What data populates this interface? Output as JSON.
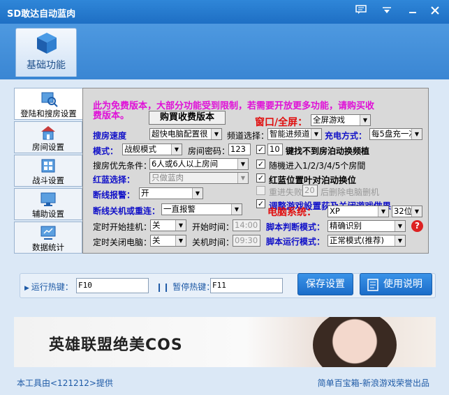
{
  "window": {
    "title": "SD敢达自动蓝肉"
  },
  "maintab": {
    "label": "基础功能"
  },
  "sidenav": [
    {
      "label": "登陆和搜房设置"
    },
    {
      "label": "房间设置"
    },
    {
      "label": "战斗设置"
    },
    {
      "label": "辅助设置"
    },
    {
      "label": "数据统计"
    }
  ],
  "panel": {
    "notice": "此为免费版本，大部分功能受到限制，若需要开放更多功能，请购买收费版本。",
    "notice_line1": "此为免费版本，大部分功能受到限制，若需要开放更多功能，请购买收",
    "notice_line2": "费版本。",
    "buy_button": "购買收费版本",
    "window_mode_label": "窗口/全屏：",
    "window_mode_value": "全屏游戏",
    "search_speed_label": "搜房速度",
    "search_speed_value": "超快电脑配置很",
    "channel_label": "频道选择：",
    "channel_value": "智能进频道",
    "charge_label": "充电方式：",
    "charge_value": "每5盘充一次",
    "mode_label": "模式：",
    "mode_value": "战舰模式",
    "room_pwd_label": "房间密码：",
    "room_pwd_value": "123",
    "chk1_value": "10",
    "chk1_label": "键找不到房泊动换频植",
    "priority_label": "搜房优先条件：",
    "priority_value": "6人或6人以上房间",
    "chk2_label": "随機进入1/2/3/4/5个房間",
    "redblue_label": "红蓝选择：",
    "redblue_value": "只做蓝肉",
    "chk3_label": "红蓝位置叶对泊动换位",
    "chk4_pre": "重进失败",
    "chk4_value": "20",
    "chk4_post": "后删除电脑删机",
    "disconnect_alarm_label": "断线报警：",
    "disconnect_alarm_value": "开",
    "chk5_label": "调整游戏設置荻及关闭遊戏做果",
    "disconnect_action_label": "断线关机或重连：",
    "disconnect_action_value": "一直报警",
    "pc_system_label": "电脑系统：",
    "os_value": "XP",
    "bits_value": "32位",
    "timed_start_label": "定时开始挂机：",
    "timed_start_value": "关",
    "start_time_label": "开始时间：",
    "start_time_value": "14:00",
    "script_judge_label": "脚本判断模式：",
    "script_judge_value": "精确识别",
    "timed_shutdown_label": "定时关闭电脑：",
    "timed_shutdown_value": "关",
    "shutdown_time_label": "关机时间：",
    "shutdown_time_value": "09:30",
    "script_run_label": "脚本运行模式：",
    "script_run_value": "正常模式(推荐)"
  },
  "hotkeys": {
    "run_label": "运行热键：",
    "run_value": "F10",
    "pause_label": "暂停热键：",
    "pause_value": "F11"
  },
  "buttons": {
    "save": "保存设置",
    "manual": "使用说明"
  },
  "banner": {
    "text": "英雄联盟绝美COS"
  },
  "footer": {
    "left": "本工具由<121212>提供",
    "right": "简单百宝箱-新浪游戏荣誉出品"
  },
  "colors": {
    "titlebar": "#1e6fc4",
    "accent_blue": "#1010c8",
    "accent_red": "#e01010",
    "accent_magenta": "#e010d8"
  }
}
